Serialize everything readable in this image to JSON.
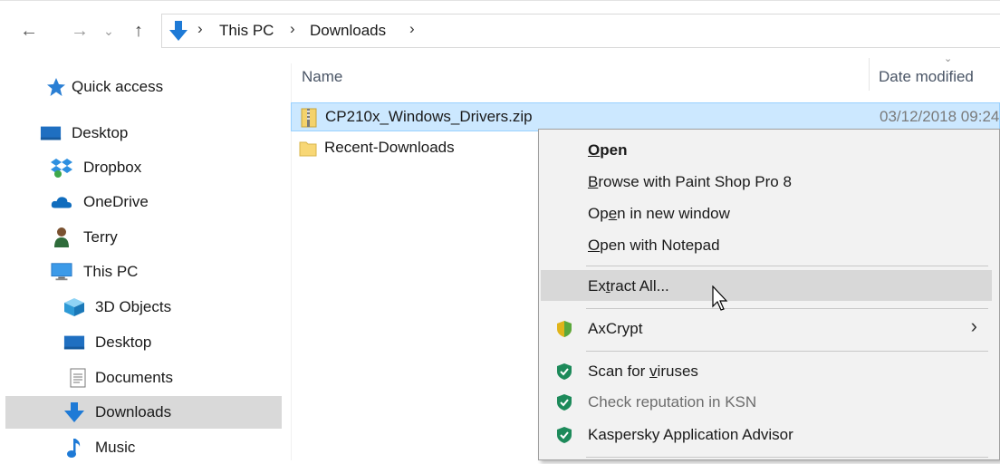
{
  "window": {
    "accent_color": "#0078d7"
  },
  "address_bar": {
    "breadcrumbs": [
      "This PC",
      "Downloads"
    ],
    "separator": "›"
  },
  "nav": {
    "back": "←",
    "forward": "→",
    "recent": "⌄",
    "up": "↑"
  },
  "sidebar": {
    "items": [
      {
        "label": "Quick access",
        "icon": "star-icon"
      },
      {
        "label": "Desktop",
        "icon": "desktop-icon"
      },
      {
        "label": "Dropbox",
        "icon": "dropbox-icon"
      },
      {
        "label": "OneDrive",
        "icon": "onedrive-icon"
      },
      {
        "label": "Terry",
        "icon": "user-icon"
      },
      {
        "label": "This PC",
        "icon": "computer-icon"
      },
      {
        "label": "3D Objects",
        "icon": "cube-icon"
      },
      {
        "label": "Desktop",
        "icon": "desktop-icon"
      },
      {
        "label": "Documents",
        "icon": "document-icon"
      },
      {
        "label": "Downloads",
        "icon": "download-icon",
        "selected": true
      },
      {
        "label": "Music",
        "icon": "music-icon"
      }
    ]
  },
  "file_list": {
    "columns": {
      "name": "Name",
      "date_modified": "Date modified"
    },
    "rows": [
      {
        "name": "CP210x_Windows_Drivers.zip",
        "date": "03/12/2018 09:24",
        "icon": "zip-folder-icon",
        "selected": true
      },
      {
        "name": "Recent-Downloads",
        "date": "",
        "icon": "folder-icon"
      }
    ]
  },
  "context_menu": {
    "items": [
      {
        "label": "Open",
        "underline_char": "O",
        "bold": true
      },
      {
        "label": "Browse with Paint Shop Pro 8",
        "underline_char": "B"
      },
      {
        "label": "Open in new window",
        "underline_char": "e"
      },
      {
        "label": "Open with Notepad",
        "underline_char": "O"
      },
      {
        "label": "Extract All...",
        "underline_char": "t",
        "hover": true
      },
      {
        "label": "AxCrypt",
        "has_submenu": true,
        "icon": "axcrypt-icon"
      },
      {
        "label": "Scan for viruses",
        "underline_char": "v",
        "icon": "kaspersky-icon"
      },
      {
        "label": "Check reputation in KSN",
        "disabled": true,
        "icon": "kaspersky-icon"
      },
      {
        "label": "Kaspersky Application Advisor",
        "icon": "kaspersky-icon"
      }
    ]
  },
  "colors": {
    "selection_bg": "#cce8ff",
    "selection_border": "#99d1ff",
    "sidebar_selected": "#d9d9d9",
    "menu_bg": "#f2f2f2",
    "menu_hover": "#d8d8d8",
    "kaspersky_green": "#1d8a5a"
  }
}
